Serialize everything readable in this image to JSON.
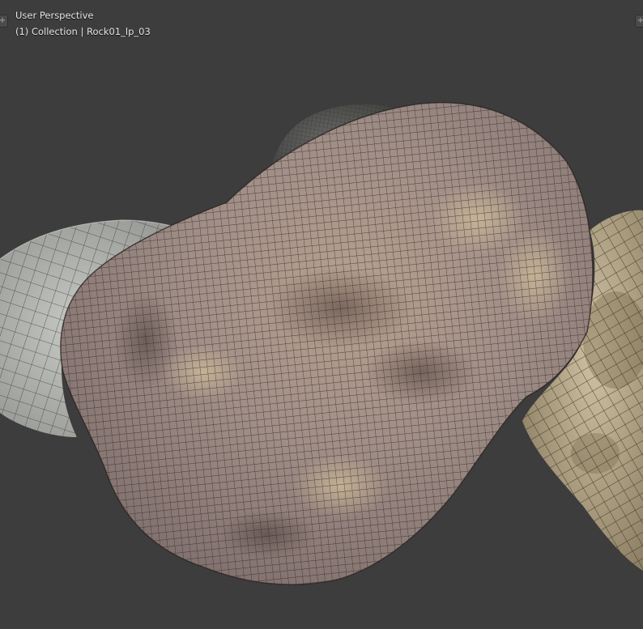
{
  "viewport": {
    "view_name": "User Perspective",
    "collection_label": "(1) Collection | Rock01_lp_03",
    "background_color": "#3d3d3d"
  },
  "objects": [
    {
      "name": "rock-left-gray",
      "color": "#b9bcb7"
    },
    {
      "name": "rock-back-dark",
      "color": "#5e5e5c"
    },
    {
      "name": "rock-right-tan",
      "color": "#b5a78b"
    },
    {
      "name": "rock-center-pink",
      "color": "#9a8a86"
    }
  ],
  "widgets": {
    "left_corner_icon": "plus-icon",
    "right_corner_icon": "plus-icon",
    "corner_glyph": "+"
  }
}
